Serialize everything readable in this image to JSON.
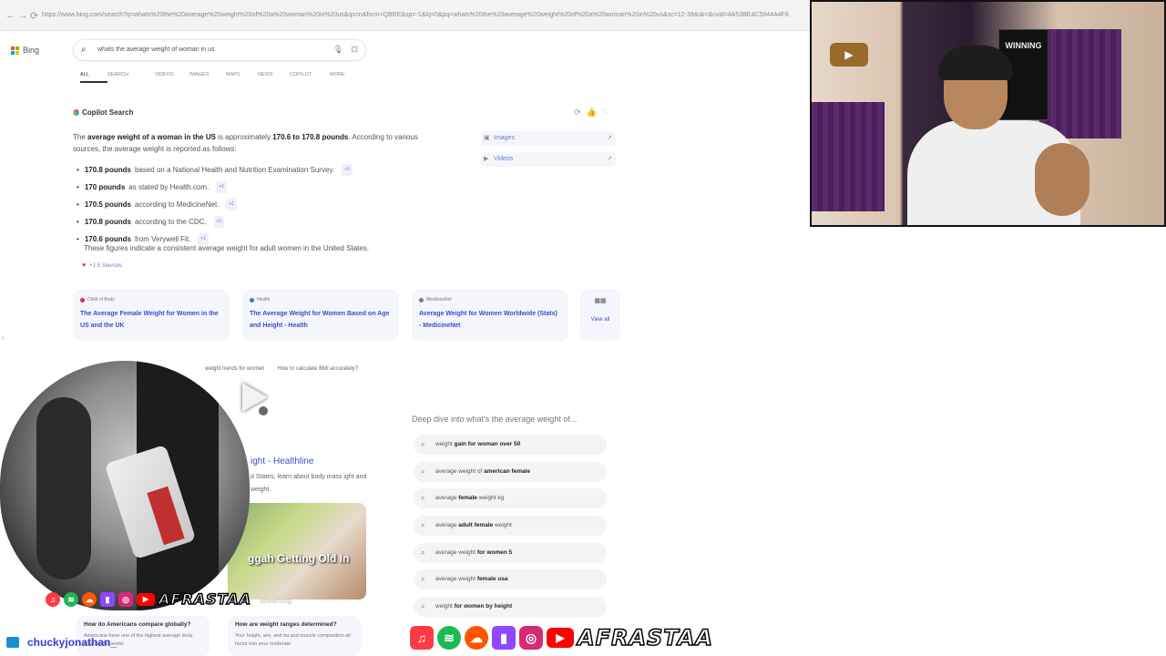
{
  "browser": {
    "back": "←",
    "forward": "→",
    "reload": "⟳",
    "url": "https://www.bing.com/search?q=whats%20the%20average%20weight%20of%20a%20woman%20in%20us&qs=n&form=QBRE&sp=-1&lq=0&pq=whats%20the%20average%20weight%20of%20a%20woman%20in%20us&sc=12-39&sk=&cvid=4A53BE4C5944A4F8"
  },
  "bing": {
    "logo": "Bing",
    "search_value": "whats the average weight of woman in us"
  },
  "tabs": [
    "ALL",
    "SEARCH",
    "VIDEOS",
    "IMAGES",
    "MAPS",
    "NEWS",
    "COPILOT",
    "MORE"
  ],
  "copilot": {
    "title": "Copilot Search",
    "lead_plain1": "The ",
    "lead_bold1": "average weight of a woman in the US",
    "lead_plain2": " is approximately ",
    "lead_bold2": "170.6 to 170.8 pounds",
    "lead_plain3": ". According to various sources, the average weight is reported as follows:",
    "bullets": [
      {
        "bold": "170.8 pounds",
        "text": "based on a National Health and Nutrition Examination Survey.",
        "cite": "+3"
      },
      {
        "bold": "170 pounds",
        "text": "as stated by Health.com.",
        "cite": "+1"
      },
      {
        "bold": "170.5 pounds",
        "text": "according to MedicineNet.",
        "cite": "+1"
      },
      {
        "bold": "170.8 pounds",
        "text": "according to the CDC.",
        "cite": "+1"
      },
      {
        "bold": "170.6 pounds",
        "text": "from Verywell Fit.",
        "cite": "+1"
      }
    ],
    "summary": "These figures indicate a consistent average weight for adult women in the United States.",
    "sources": "+1 5 Sources",
    "side_buttons": [
      "Images",
      "Videos"
    ]
  },
  "cards": [
    {
      "source": "Child of Body",
      "title": "The Average Female Weight for Women in the US and the UK"
    },
    {
      "source": "Health",
      "title": "The Average Weight for Women Based on Age and Height - Health"
    },
    {
      "source": "MedicineNet",
      "title": "Average Weight for Women Worldwide (Stats) - MedicineNet"
    }
  ],
  "view_all": "View all",
  "chips": [
    "weight trends for women",
    "How to calculate BMI accurately?"
  ],
  "deep_dive": {
    "title": "Deep dive into what's the average weight of...",
    "items": [
      {
        "plain": "weight ",
        "bold": "gain for woman over 50",
        "tail": ""
      },
      {
        "plain": "average weight of ",
        "bold": "american female",
        "tail": ""
      },
      {
        "plain": "average ",
        "bold": "female",
        "tail": " weight kg"
      },
      {
        "plain": "average ",
        "bold": "adult female",
        "tail": " weight"
      },
      {
        "plain": "average weight ",
        "bold": "for women 5",
        "tail": ""
      },
      {
        "plain": "average weight ",
        "bold": "female usa",
        "tail": ""
      },
      {
        "plain": "weight ",
        "bold": "for women by height",
        "tail": ""
      }
    ]
  },
  "result": {
    "title": "ight - Healthline",
    "snippet": "d States, learn about body mass ight and weight.",
    "thumb_text": "ggah Getting Old In",
    "faded": "streaming"
  },
  "questions": [
    {
      "q": "How do Americans compare globally?",
      "d": "Americans have one of the highest average body mass in the world."
    },
    {
      "q": "How are weight ranges determined?",
      "d": "Your height, sex, and fat and muscle composition all factor into your moderate"
    }
  ],
  "overlay": {
    "poster_text": "WINNING",
    "brand": "AFRASTAA",
    "brand_small": "AFRASTAA",
    "chat_name": "chuckyjonathan_",
    "social_icons": [
      "music-icon",
      "spotify-icon",
      "soundcloud-icon",
      "twitch-icon",
      "instagram-icon",
      "youtube-icon"
    ]
  },
  "colors": {
    "link": "#3b4bd0",
    "chip_bg": "#f4f6fb",
    "twitch": "#9146ff",
    "youtube": "#ff0000",
    "spotify": "#1db954",
    "soundcloud": "#ff5500"
  }
}
